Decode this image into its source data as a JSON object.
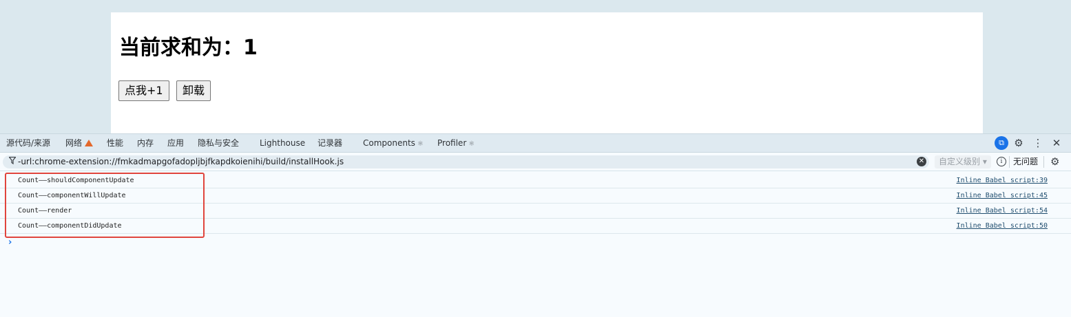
{
  "app": {
    "heading": "当前求和为：1",
    "add_button": "点我+1",
    "unmount_button": "卸载"
  },
  "devtools": {
    "tabs": [
      {
        "label": "源代码/来源"
      },
      {
        "label": "网络",
        "warning": true
      },
      {
        "label": "性能"
      },
      {
        "label": "内存"
      },
      {
        "label": "应用"
      },
      {
        "label": "隐私与安全"
      },
      {
        "label": "Lighthouse"
      },
      {
        "label": "记录器"
      },
      {
        "label": "Components",
        "react_icon": "⚛"
      },
      {
        "label": "Profiler",
        "react_icon": "⚛"
      }
    ],
    "toolbar_icons": {
      "badge": "⧉",
      "settings": "⚙",
      "more": "⋮",
      "close": "✕"
    },
    "filter": {
      "text": "-url:chrome-extension://fmkadmapgofadopljbjfkapdkoienihi/build/installHook.js",
      "clear_icon": "✕",
      "level_label": "自定义级别 ▾",
      "info_icon": "i",
      "issues_label": "无问题",
      "settings_icon": "⚙"
    },
    "console": {
      "logs": [
        {
          "message": "Count——shouldComponentUpdate",
          "source": "Inline Babel script:39"
        },
        {
          "message": "Count——componentWillUpdate",
          "source": "Inline Babel script:45"
        },
        {
          "message": "Count——render",
          "source": "Inline Babel script:54"
        },
        {
          "message": "Count——componentDidUpdate",
          "source": "Inline Babel script:50"
        }
      ],
      "prompt": "›"
    },
    "accent_color": "#1a73e8",
    "highlight_color": "#e0443c"
  }
}
